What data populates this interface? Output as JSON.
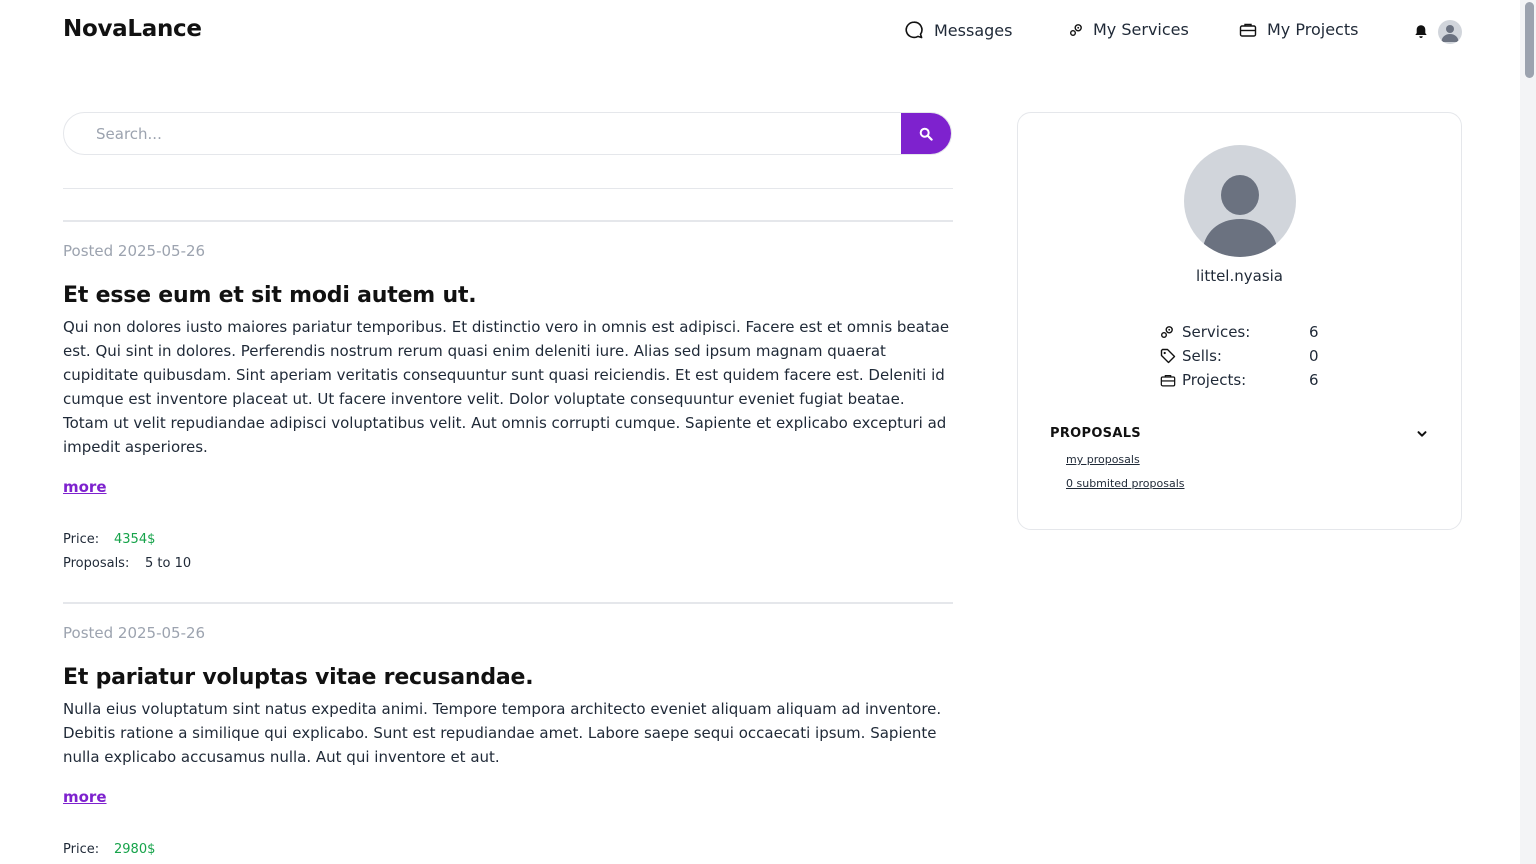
{
  "header": {
    "brand": "NovaLance",
    "nav": {
      "messages": "Messages",
      "services": "My Services",
      "projects": "My Projects"
    }
  },
  "search": {
    "placeholder": "Search..."
  },
  "posts": [
    {
      "date": "Posted 2025-05-26",
      "title": "Et esse eum et sit modi autem ut.",
      "body": "Qui non dolores iusto maiores pariatur temporibus. Et distinctio vero in omnis est adipisci. Facere est et omnis beatae est. Qui sint in dolores. Perferendis nostrum rerum quasi enim deleniti iure. Alias sed ipsum magnam quaerat cupiditate quibusdam. Sint aperiam veritatis consequuntur sunt quasi reiciendis. Et est quidem facere est. Deleniti id cumque est inventore placeat ut. Ut facere inventore velit. Dolor voluptate consequuntur eveniet fugiat beatae. Totam ut velit repudiandae adipisci voluptatibus velit. Aut omnis corrupti cumque. Sapiente et explicabo excepturi ad impedit asperiores.",
      "more": "more",
      "price_label": "Price:",
      "price": "4354$",
      "proposals_label": "Proposals:",
      "proposals": "5 to 10"
    },
    {
      "date": "Posted 2025-05-26",
      "title": "Et pariatur voluptas vitae recusandae.",
      "body": "Nulla eius voluptatum sint natus expedita animi. Tempore tempora architecto eveniet aliquam aliquam ad inventore. Debitis ratione a similique qui explicabo. Sunt est repudiandae amet. Labore saepe sequi occaecati ipsum. Sapiente nulla explicabo accusamus nulla. Aut qui inventore et aut.",
      "more": "more",
      "price_label": "Price:",
      "price": "2980$"
    }
  ],
  "profile": {
    "username": "littel.nyasia",
    "stats": {
      "services_label": "Services:",
      "services": "6",
      "sells_label": "Sells:",
      "sells": "0",
      "projects_label": "Projects:",
      "projects": "6"
    },
    "proposals": {
      "heading": "PROPOSALS",
      "my_link": "my proposals",
      "submitted_link": "0 submited proposals"
    }
  },
  "colors": {
    "accent": "#7e22ce",
    "price": "#16a34a",
    "muted": "#9ca3af",
    "border": "#e5e7eb"
  },
  "icons": {
    "messages": "chat-bubble-icon",
    "services": "gears-icon",
    "projects": "briefcase-icon",
    "notifications": "bell-icon",
    "search": "magnifier-icon",
    "sells": "tag-icon",
    "expand": "chevron-down-icon"
  }
}
